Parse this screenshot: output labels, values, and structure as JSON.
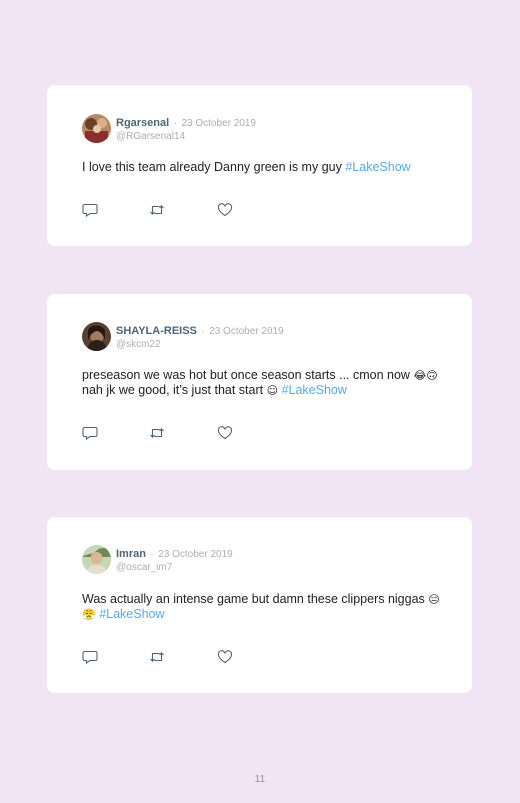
{
  "tweets": [
    {
      "name": "Rgarsenal",
      "separator": "·",
      "date": "23 October 2019",
      "handle": "@RGarsenal14",
      "text": "I love this team already Danny green is my guy",
      "emojis": "",
      "hashtag": "#LakeShow",
      "avatar_colors": [
        "#7a4a30",
        "#c99a6e"
      ]
    },
    {
      "name": "SHAYLA-REISS",
      "separator": "·",
      "date": "23 October 2019",
      "handle": "@skcm22",
      "text": "preseason we was hot but once season starts ... cmon now",
      "emojis": "😂🙃",
      "text2": "nah jk we good, it’s just that start",
      "emoji2": "☺",
      "hashtag": "#LakeShow",
      "avatar_colors": [
        "#3b2a22",
        "#8c6450"
      ]
    },
    {
      "name": "Imran",
      "separator": "·",
      "date": "23 October 2019",
      "handle": "@oscar_im7",
      "text": "Was actually an intense game but damn these clippers niggas",
      "emojis": "😑😤",
      "hashtag": "#LakeShow",
      "avatar_colors": [
        "#6e8a55",
        "#d8c8a8"
      ]
    }
  ],
  "icons": {
    "reply": "reply-icon",
    "retweet": "retweet-icon",
    "like": "heart-icon"
  },
  "colors": {
    "background": "#f1e4f4",
    "card": "#ffffff",
    "hashtag": "#55acee",
    "name": "#4f6577",
    "muted": "#a7b0b8"
  },
  "page_number": "11"
}
